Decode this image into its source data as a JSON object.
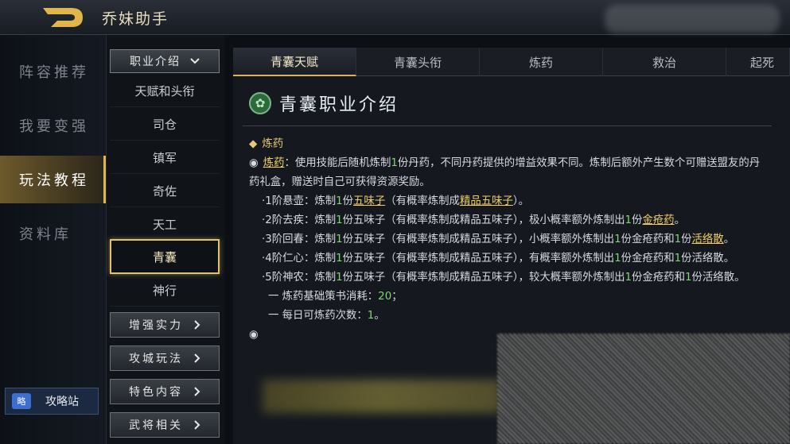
{
  "app": {
    "title": "乔妹助手"
  },
  "nav": {
    "items": [
      {
        "label": "阵容推荐"
      },
      {
        "label": "我要变强"
      },
      {
        "label": "玩法教程"
      },
      {
        "label": "资料库"
      }
    ],
    "active": "玩法教程"
  },
  "strategy_site": {
    "label": "攻略站",
    "icon": "略"
  },
  "submenu": {
    "dropdown_label": "职业介绍",
    "items": [
      {
        "label": "天赋和头衔"
      },
      {
        "label": "司仓"
      },
      {
        "label": "镇军"
      },
      {
        "label": "奇佐"
      },
      {
        "label": "天工"
      },
      {
        "label": "青囊"
      },
      {
        "label": "神行"
      }
    ],
    "active": "青囊",
    "sections": [
      {
        "label": "增强实力"
      },
      {
        "label": "攻城玩法"
      },
      {
        "label": "特色内容"
      },
      {
        "label": "武将相关"
      }
    ]
  },
  "tabs": [
    {
      "label": "青囊天赋"
    },
    {
      "label": "青囊头衔"
    },
    {
      "label": "炼药"
    },
    {
      "label": "救治"
    },
    {
      "label": "起死"
    }
  ],
  "active_tab": "青囊天赋",
  "content": {
    "title": "青囊职业介绍",
    "title_icon": "lotus-icon",
    "section_heading": "炼药",
    "intro": {
      "term": "炼药",
      "text_1": "：使用技能后随机炼制",
      "num": "1",
      "text_2": "份丹药，不同丹药提供的增益效果不同。炼制后额外产生数个可赠送盟友的丹药礼盒，赠送时自己可获得资源奖励。"
    },
    "tier1": {
      "a": "·1阶悬壶：炼制",
      "n": "1",
      "b": "份",
      "link1": "五味子",
      "c": "（有概率炼制成",
      "link2": "精品五味子",
      "d": "）。"
    },
    "tier2": {
      "a": "·2阶去疾：炼制",
      "n1": "1",
      "b": "份五味子（有概率炼制成精品五味子），极小概率额外炼制出",
      "n2": "1",
      "c": "份",
      "link": "金疮药",
      "d": "。"
    },
    "tier3": {
      "a": "·3阶回春：炼制",
      "n1": "1",
      "b": "份五味子（有概率炼制成精品五味子），小概率额外炼制出",
      "n2": "1",
      "c": "份金疮药和",
      "n3": "1",
      "d": "份",
      "link": "活络散",
      "e": "。"
    },
    "tier4": {
      "a": "·4阶仁心：炼制",
      "n1": "1",
      "b": "份五味子（有概率炼制成精品五味子），有概率额外炼制出",
      "n2": "1",
      "c": "份金疮药和",
      "n3": "1",
      "d": "份活络散。"
    },
    "tier5": {
      "a": "·5阶神农：炼制",
      "n1": "1",
      "b": "份五味子（有概率炼制成精品五味子），较大概率额外炼制出",
      "n2": "1",
      "c": "份金疮药和",
      "n3": "1",
      "d": "份活络散。"
    },
    "cost": {
      "label": "一 炼药基础策书消耗：",
      "value": "20",
      "end": "；"
    },
    "daily": {
      "label": "一 每日可炼药次数：",
      "value": "1",
      "end": "。"
    }
  }
}
